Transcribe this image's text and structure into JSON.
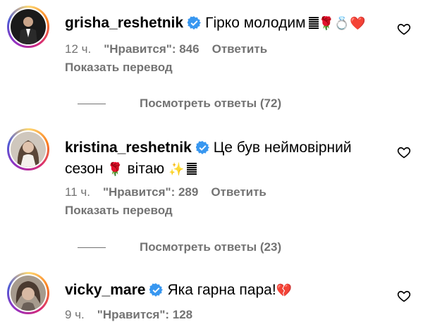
{
  "comments": [
    {
      "username": "grisha_reshetnik",
      "text": "Гірко молодим",
      "emoji": "🌹💍❤️",
      "time": "12 ч.",
      "likes": "\"Нравится\": 846",
      "reply": "Ответить",
      "translate": "Показать перевод",
      "view_replies": "Посмотреть ответы (72)"
    },
    {
      "username": "kristina_reshetnik",
      "text_line1": "Це був неймовірний",
      "text_line2": "сезон",
      "rose": "🌹",
      "text_line2b": "вітаю",
      "sparkles": "✨",
      "time": "11 ч.",
      "likes": "\"Нравится\": 289",
      "reply": "Ответить",
      "translate": "Показать перевод",
      "view_replies": "Посмотреть ответы (23)"
    },
    {
      "username": "vicky_mare",
      "text": "Яка гарна пара!",
      "emoji": "💔",
      "time": "9 ч.",
      "likes": "\"Нравится\": 128"
    }
  ],
  "colors": {
    "verified": "#3897f0",
    "muted": "#737373"
  },
  "icons": [
    "verified-badge-icon",
    "heart-outline-icon",
    "flag-icon"
  ]
}
